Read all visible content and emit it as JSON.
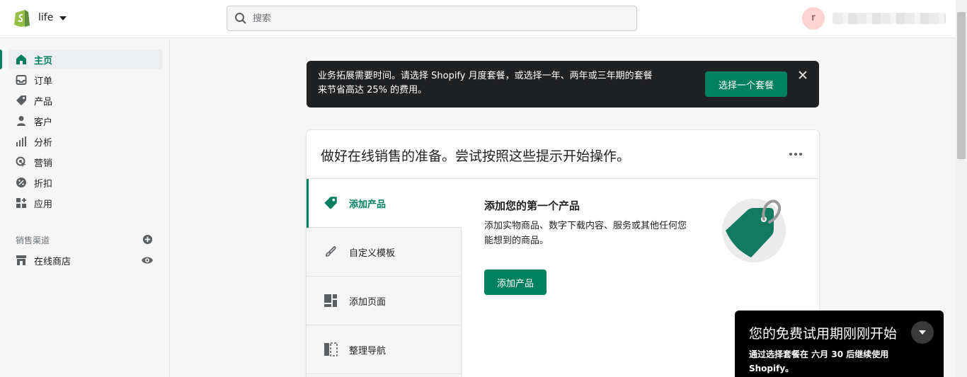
{
  "topbar": {
    "store_name": "life",
    "search_placeholder": "搜索",
    "avatar_initial": "r"
  },
  "sidebar": {
    "items": [
      {
        "label": "主页",
        "icon": "home-icon",
        "active": true
      },
      {
        "label": "订单",
        "icon": "orders-icon"
      },
      {
        "label": "产品",
        "icon": "tag-icon"
      },
      {
        "label": "客户",
        "icon": "person-icon"
      },
      {
        "label": "分析",
        "icon": "bar-chart-icon"
      },
      {
        "label": "营销",
        "icon": "target-icon"
      },
      {
        "label": "折扣",
        "icon": "discount-icon"
      },
      {
        "label": "应用",
        "icon": "apps-icon"
      }
    ],
    "channels_title": "销售渠道",
    "channels": [
      {
        "label": "在线商店",
        "icon": "store-icon"
      }
    ]
  },
  "banner": {
    "line1": "业务拓展需要时间。请选择 Shopify 月度套餐，或选择一年、两年或三年期的套餐",
    "line2": "来节省高达 25% 的费用。",
    "button_label": "选择一个套餐"
  },
  "card": {
    "title": "做好在线销售的准备。尝试按照这些提示开始操作。",
    "tasks": [
      {
        "label": "添加产品",
        "icon": "tag-icon",
        "active": true
      },
      {
        "label": "自定义模板",
        "icon": "brush-icon"
      },
      {
        "label": "添加页面",
        "icon": "page-layout-icon"
      },
      {
        "label": "整理导航",
        "icon": "navigation-icon"
      }
    ],
    "detail": {
      "title": "添加您的第一个产品",
      "description": "添加实物商品、数字下载内容、服务或其他任何您能想到的商品。",
      "button_label": "添加产品"
    }
  },
  "trial": {
    "title": "您的免费试用期刚刚开始",
    "body": "通过选择套餐在 六月 30 后继续使用 Shopify。"
  },
  "colors": {
    "brand_green": "#008060",
    "banner_bg": "#202123"
  }
}
